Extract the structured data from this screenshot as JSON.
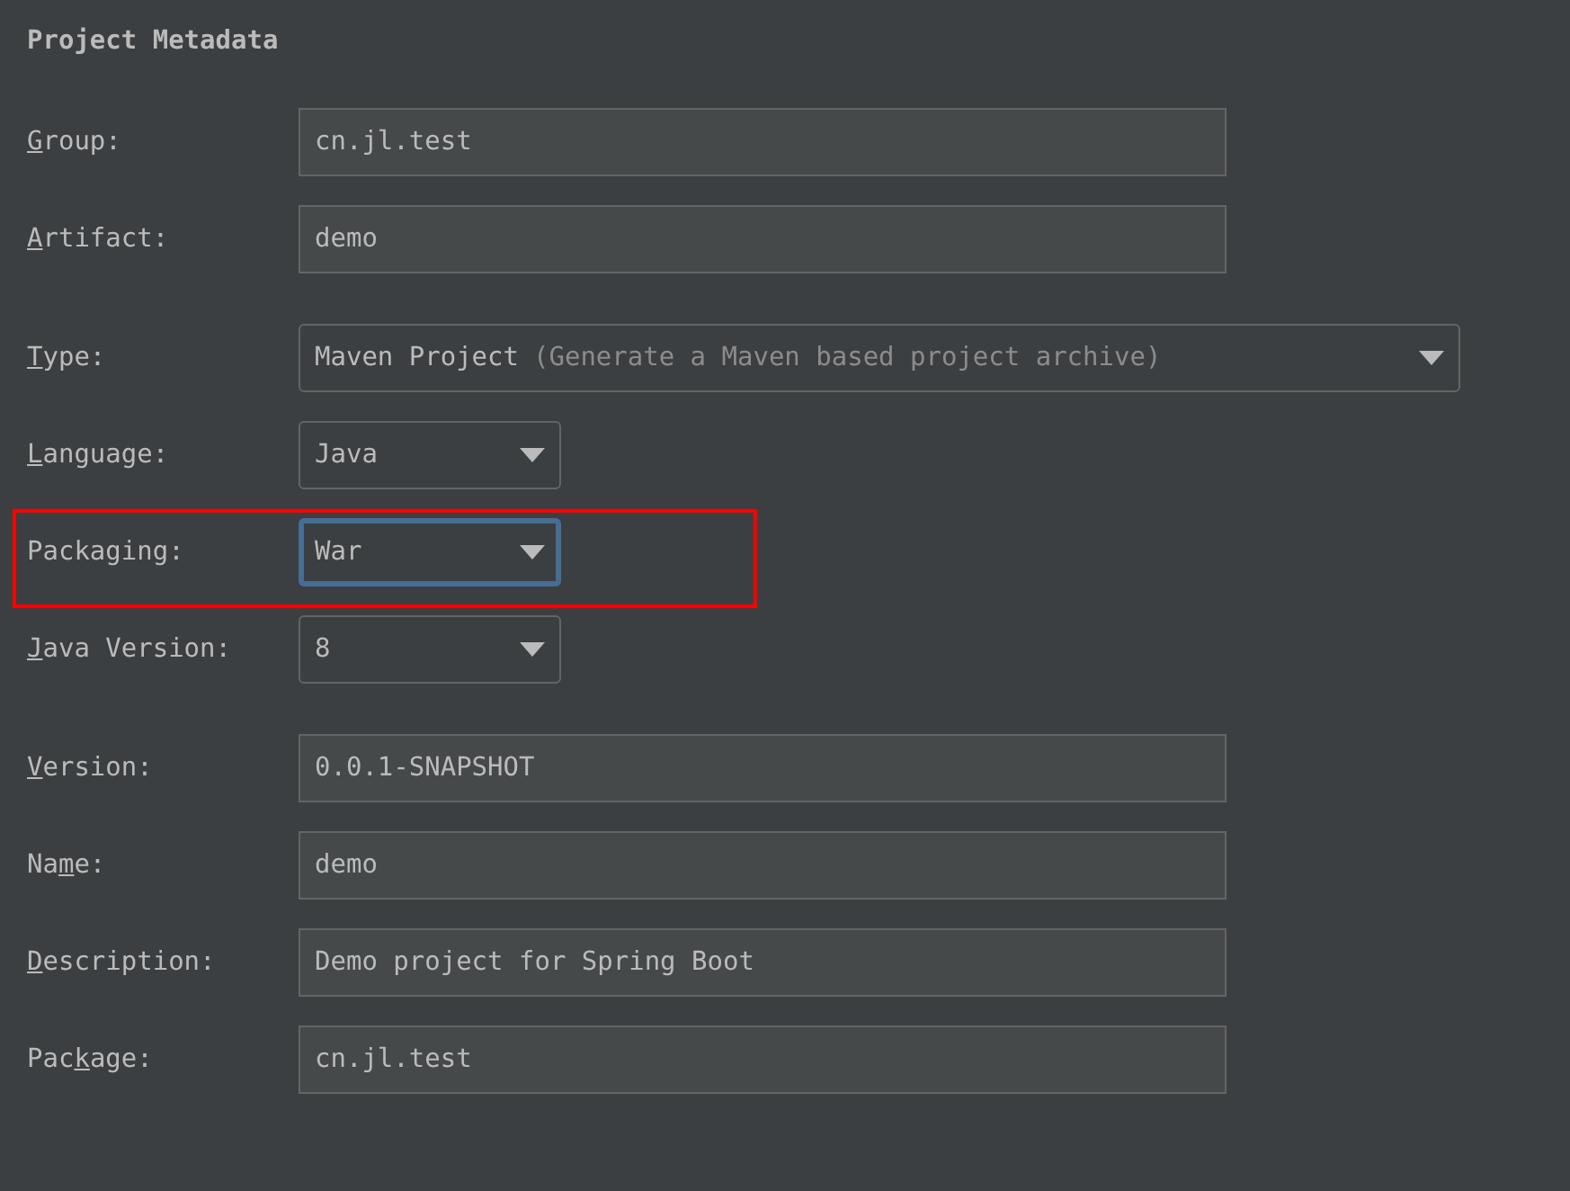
{
  "title": "Project Metadata",
  "sections": [
    {
      "rows": [
        {
          "kind": "text",
          "label": [
            {
              "text": "G",
              "underlined": true
            },
            {
              "text": "roup:",
              "underlined": false
            }
          ],
          "value": "cn.jl.test"
        },
        {
          "kind": "text",
          "label": [
            {
              "text": "A",
              "underlined": true
            },
            {
              "text": "rtifact:",
              "underlined": false
            }
          ],
          "value": "demo"
        }
      ]
    },
    {
      "rows": [
        {
          "kind": "wide-select",
          "label": [
            {
              "text": "T",
              "underlined": true
            },
            {
              "text": "ype:",
              "underlined": false
            }
          ],
          "value": "Maven Project",
          "hint": "(Generate a Maven based project archive)"
        },
        {
          "kind": "select",
          "label": [
            {
              "text": "L",
              "underlined": true
            },
            {
              "text": "anguage:",
              "underlined": false
            }
          ],
          "value": "Java",
          "focused": false,
          "highlighted": false
        },
        {
          "kind": "select",
          "label": [
            {
              "text": "Packaging:",
              "underlined": false
            }
          ],
          "value": "War",
          "focused": true,
          "highlighted": true
        },
        {
          "kind": "select",
          "label": [
            {
              "text": "J",
              "underlined": true
            },
            {
              "text": "ava Version:",
              "underlined": false
            }
          ],
          "value": "8",
          "focused": false,
          "highlighted": false
        }
      ]
    },
    {
      "rows": [
        {
          "kind": "text",
          "label": [
            {
              "text": "V",
              "underlined": true
            },
            {
              "text": "ersion:",
              "underlined": false
            }
          ],
          "value": "0.0.1-SNAPSHOT"
        },
        {
          "kind": "text",
          "label": [
            {
              "text": "Na",
              "underlined": false
            },
            {
              "text": "m",
              "underlined": true
            },
            {
              "text": "e:",
              "underlined": false
            }
          ],
          "value": "demo"
        },
        {
          "kind": "text",
          "label": [
            {
              "text": "D",
              "underlined": true
            },
            {
              "text": "escription:",
              "underlined": false
            }
          ],
          "value": "Demo project for Spring Boot"
        },
        {
          "kind": "text",
          "label": [
            {
              "text": "Pac",
              "underlined": false
            },
            {
              "text": "k",
              "underlined": true
            },
            {
              "text": "age:",
              "underlined": false
            }
          ],
          "value": "cn.jl.test"
        }
      ]
    }
  ]
}
